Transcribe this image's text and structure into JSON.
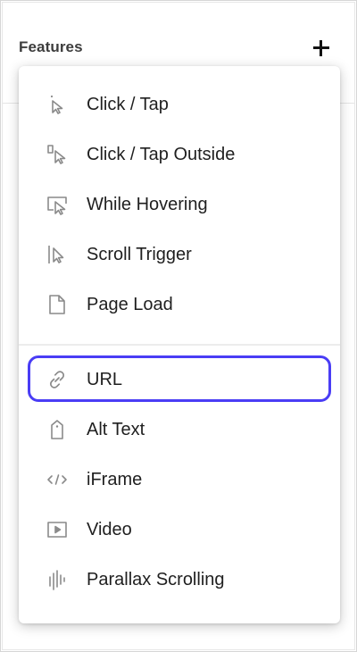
{
  "panel": {
    "title": "Features"
  },
  "menu": {
    "group_triggers": [
      {
        "label": "Click / Tap",
        "icon": "click-cursor-icon"
      },
      {
        "label": "Click / Tap Outside",
        "icon": "click-outside-icon"
      },
      {
        "label": "While Hovering",
        "icon": "hover-icon"
      },
      {
        "label": "Scroll Trigger",
        "icon": "scroll-trigger-icon"
      },
      {
        "label": "Page Load",
        "icon": "page-icon"
      }
    ],
    "group_features": [
      {
        "label": "URL",
        "icon": "link-icon",
        "selected": true
      },
      {
        "label": "Alt Text",
        "icon": "alt-text-tag-icon"
      },
      {
        "label": "iFrame",
        "icon": "code-icon"
      },
      {
        "label": "Video",
        "icon": "video-play-icon"
      },
      {
        "label": "Parallax Scrolling",
        "icon": "parallax-icon"
      }
    ]
  },
  "colors": {
    "selection_border": "#4a3df5",
    "icon_gray": "#8a8a8a",
    "text": "#1f1f1f"
  }
}
